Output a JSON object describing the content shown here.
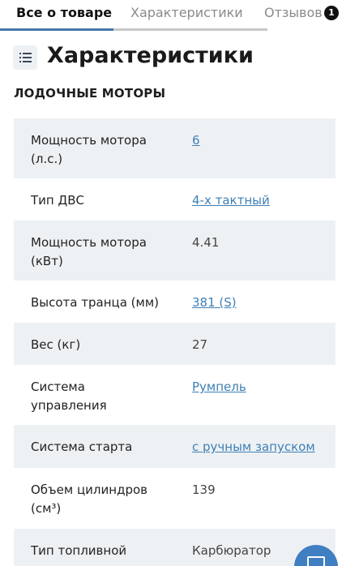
{
  "tabs": [
    {
      "label": "Все о товаре",
      "active": true
    },
    {
      "label": "Характеристики",
      "active": false
    },
    {
      "label": "Отзывов",
      "active": false,
      "badge": "1"
    }
  ],
  "section": {
    "title": "Характеристики",
    "icon": "list-icon"
  },
  "category": "ЛОДОЧНЫЕ МОТОРЫ",
  "specs": [
    {
      "label": "Мощность мотора (л.с.)",
      "value": "6",
      "link": true
    },
    {
      "label": "Тип ДВС",
      "value": "4-х тактный",
      "link": true
    },
    {
      "label": "Мощность мотора (кВт)",
      "value": "4.41",
      "link": false
    },
    {
      "label": "Высота транца (мм)",
      "value": "381 (S)",
      "link": true
    },
    {
      "label": "Вес (кг)",
      "value": "27",
      "link": false
    },
    {
      "label": "Система управления",
      "value": "Румпель",
      "link": true
    },
    {
      "label": "Система старта",
      "value": "с ручным запуском",
      "link": true
    },
    {
      "label": "Объем цилиндров (см³)",
      "value": "139",
      "link": false
    },
    {
      "label": "Тип топливной системы",
      "value": "Карбюратор",
      "link": false
    }
  ],
  "chat_button": {
    "icon": "envelope-icon"
  },
  "colors": {
    "accent": "#4677a8",
    "link": "#3f7fb5",
    "row_shade": "#eef1f4",
    "chat": "#3f7fc2"
  }
}
